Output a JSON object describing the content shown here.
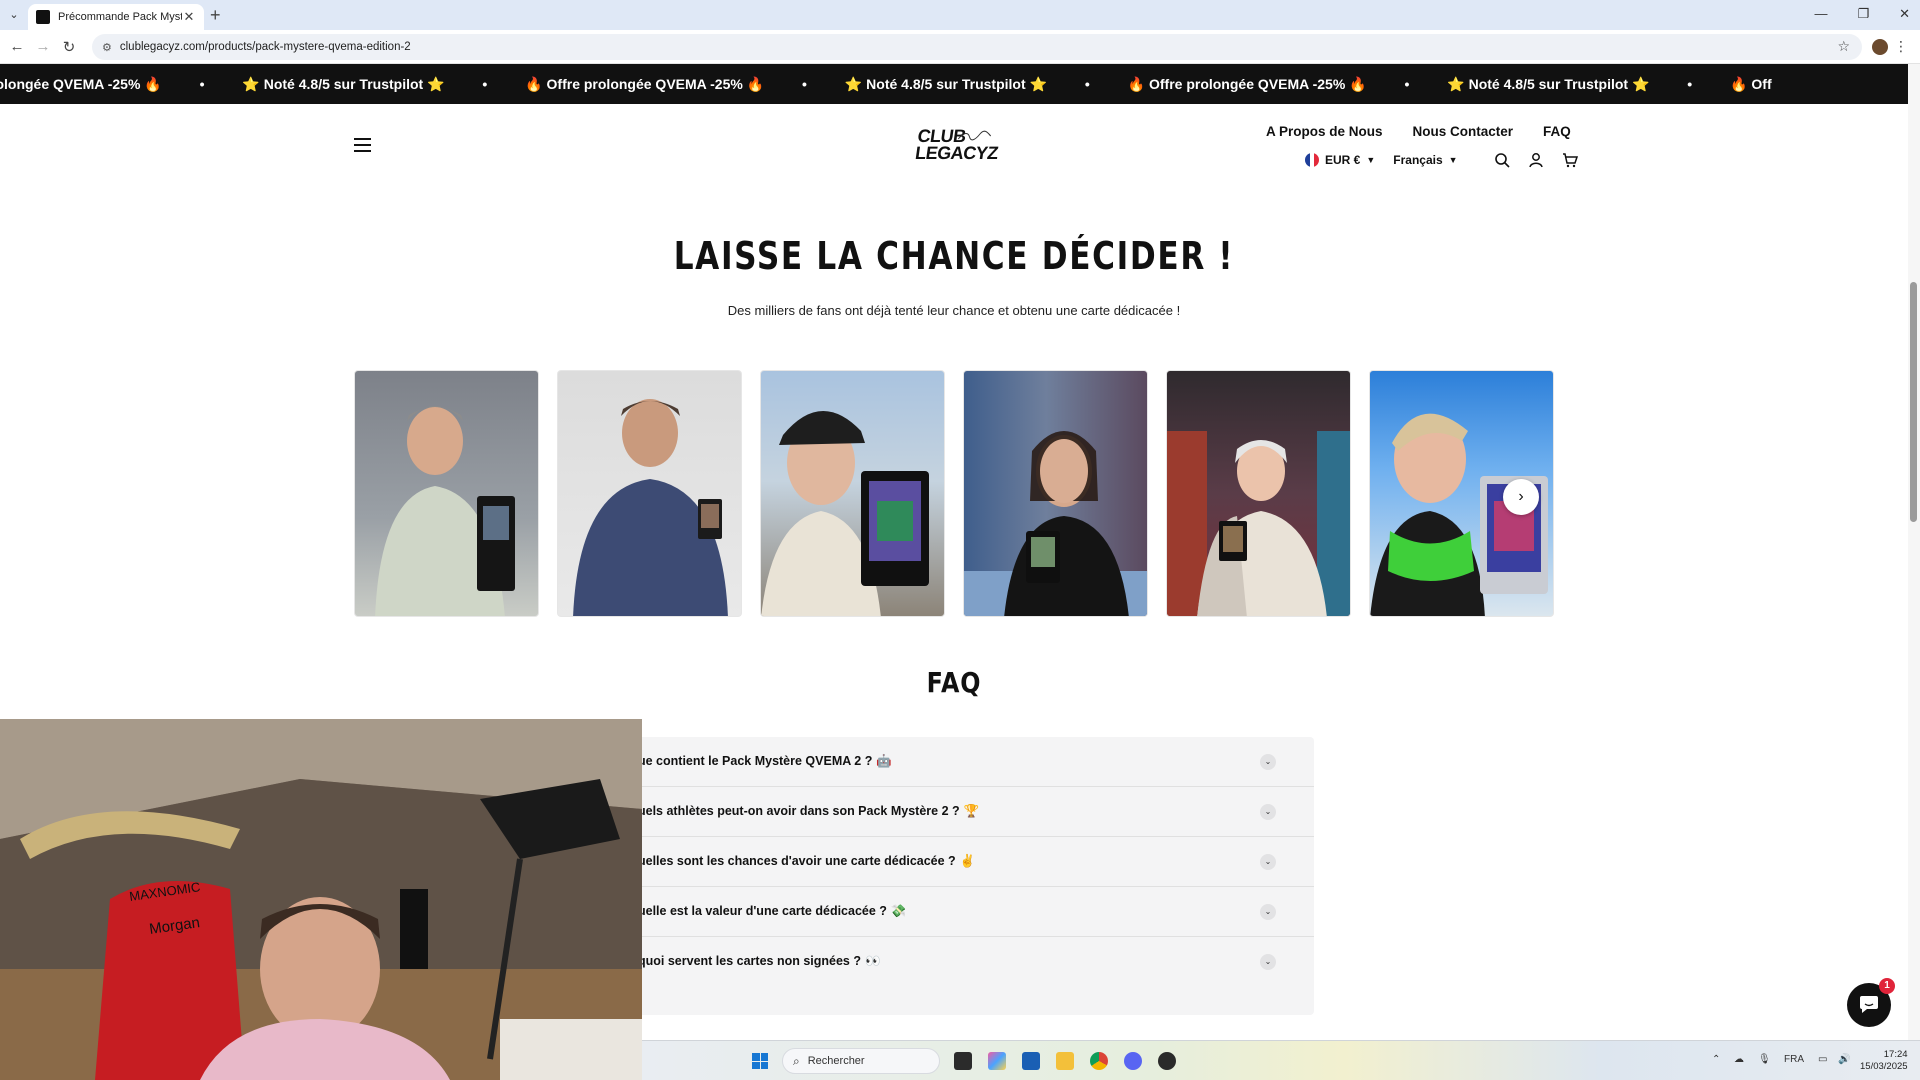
{
  "browser": {
    "tab_title": "Précommande Pack Mystère Q",
    "url": "clublegacyz.com/products/pack-mystere-qvema-edition-2",
    "new_tab": "+"
  },
  "marquee": {
    "items": [
      "rolongée QVEMA -25% 🔥",
      "⭐ Noté 4.8/5 sur Trustpilot ⭐",
      "🔥 Offre prolongée QVEMA -25% 🔥",
      "⭐ Noté 4.8/5 sur Trustpilot ⭐",
      "🔥 Offre prolongée QVEMA -25% 🔥",
      "⭐ Noté 4.8/5 sur Trustpilot ⭐",
      "🔥 Off"
    ],
    "separator": "•"
  },
  "header": {
    "logo_line1": "CLUB",
    "logo_line2": "LEGACYZ",
    "nav": [
      "A Propos de Nous",
      "Nous Contacter",
      "FAQ"
    ],
    "currency": "EUR €",
    "language": "Français"
  },
  "section": {
    "headline": "LAISSE LA CHANCE DÉCIDER !",
    "subline": "Des milliers de fans ont déjà tenté leur chance et obtenu une carte dédicacée !"
  },
  "faq": {
    "title": "FAQ",
    "items": [
      {
        "q": "ue contient le Pack Mystère QVEMA 2 ?",
        "emoji": "🤖"
      },
      {
        "q": "uels athlètes peut-on avoir dans son Pack Mystère 2 ?",
        "emoji": "🏆"
      },
      {
        "q": "uelles sont les chances d'avoir une carte dédicacée ?",
        "emoji": "✌️"
      },
      {
        "q": "uelle est la valeur d'une carte dédicacée ?",
        "emoji": "💸"
      },
      {
        "q": "quoi servent les cartes non signées ?",
        "emoji": "👀"
      }
    ]
  },
  "chat": {
    "badge": "1"
  },
  "taskbar": {
    "search_placeholder": "Rechercher",
    "lang": "FRA",
    "time": "17:24",
    "date": "15/03/2025"
  }
}
